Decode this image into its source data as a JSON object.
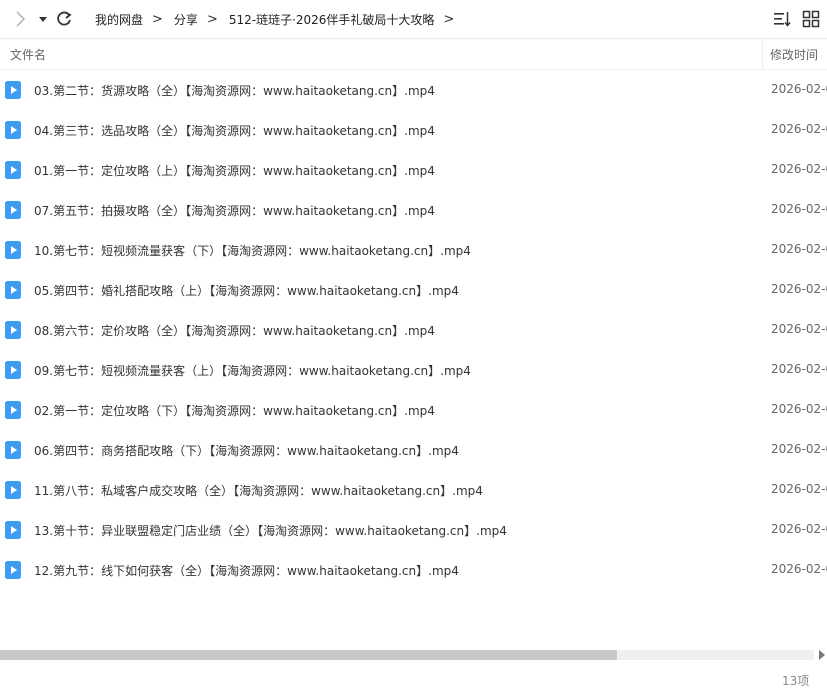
{
  "breadcrumb": [
    "我的网盘",
    "分享",
    "512-琏琏子·2026伴手礼破局十大攻略"
  ],
  "columns": {
    "name": "文件名",
    "modified": "修改时间"
  },
  "files": [
    {
      "name": "03.第二节：货源攻略（全）【海淘资源网：www.haitaoketang.cn】.mp4",
      "date": "2026-02-0"
    },
    {
      "name": "04.第三节：选品攻略（全）【海淘资源网：www.haitaoketang.cn】.mp4",
      "date": "2026-02-0"
    },
    {
      "name": "01.第一节：定位攻略（上）【海淘资源网：www.haitaoketang.cn】.mp4",
      "date": "2026-02-0"
    },
    {
      "name": "07.第五节：拍摄攻略（全）【海淘资源网：www.haitaoketang.cn】.mp4",
      "date": "2026-02-0"
    },
    {
      "name": "10.第七节：短视频流量获客（下）【海淘资源网：www.haitaoketang.cn】.mp4",
      "date": "2026-02-0"
    },
    {
      "name": "05.第四节：婚礼搭配攻略（上）【海淘资源网：www.haitaoketang.cn】.mp4",
      "date": "2026-02-0"
    },
    {
      "name": "08.第六节：定价攻略（全）【海淘资源网：www.haitaoketang.cn】.mp4",
      "date": "2026-02-0"
    },
    {
      "name": "09.第七节：短视频流量获客（上）【海淘资源网：www.haitaoketang.cn】.mp4",
      "date": "2026-02-0"
    },
    {
      "name": "02.第一节：定位攻略（下）【海淘资源网：www.haitaoketang.cn】.mp4",
      "date": "2026-02-0"
    },
    {
      "name": "06.第四节：商务搭配攻略（下）【海淘资源网：www.haitaoketang.cn】.mp4",
      "date": "2026-02-0"
    },
    {
      "name": "11.第八节：私域客户成交攻略（全）【海淘资源网：www.haitaoketang.cn】.mp4",
      "date": "2026-02-0"
    },
    {
      "name": "13.第十节：异业联盟稳定门店业绩（全）【海淘资源网：www.haitaoketang.cn】.mp4",
      "date": "2026-02-0"
    },
    {
      "name": "12.第九节：线下如何获客（全）【海淘资源网：www.haitaoketang.cn】.mp4",
      "date": "2026-02-0"
    }
  ],
  "footer": {
    "count": "13项"
  },
  "icons": {
    "file": "video-file-icon",
    "forward": "chevron-right-icon",
    "dropdown": "caret-down-icon",
    "refresh": "refresh-icon",
    "sort": "sort-icon",
    "view": "grid-view-icon"
  },
  "colors": {
    "accent": "#3d9df3",
    "text": "#333333",
    "muted": "#888888"
  }
}
